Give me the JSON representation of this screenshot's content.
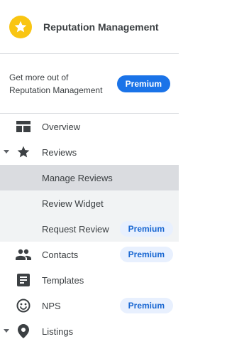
{
  "app": {
    "title": "Reputation Management",
    "logo_icon": "star-icon",
    "accent_color": "#f9c512"
  },
  "promo": {
    "text_line1": "Get more out of",
    "text_line2": "Reputation Management",
    "button_label": "Premium"
  },
  "nav": {
    "overview": {
      "label": "Overview",
      "icon": "dashboard-icon"
    },
    "reviews": {
      "label": "Reviews",
      "icon": "star-icon",
      "expanded": true
    },
    "manage_reviews": {
      "label": "Manage Reviews"
    },
    "review_widget": {
      "label": "Review Widget"
    },
    "request_review": {
      "label": "Request Review",
      "badge": "Premium"
    },
    "contacts": {
      "label": "Contacts",
      "icon": "people-icon",
      "badge": "Premium"
    },
    "templates": {
      "label": "Templates",
      "icon": "document-icon"
    },
    "nps": {
      "label": "NPS",
      "icon": "smiley-icon",
      "badge": "Premium"
    },
    "listings": {
      "label": "Listings",
      "icon": "location-pin-icon"
    }
  }
}
